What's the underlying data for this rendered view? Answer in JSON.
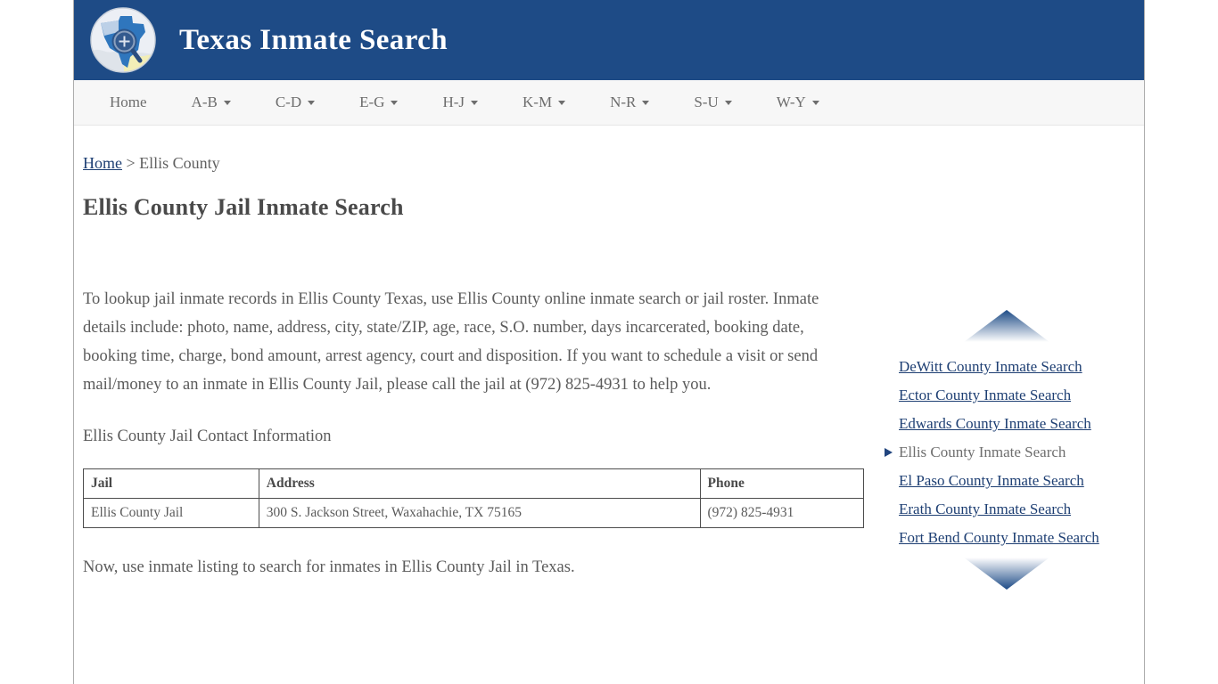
{
  "header": {
    "title": "Texas Inmate Search",
    "logo_icon": "texas-globe-magnifier-icon",
    "background_color": "#1e4b86"
  },
  "nav": {
    "items": [
      {
        "label": "Home",
        "has_caret": false
      },
      {
        "label": "A-B",
        "has_caret": true
      },
      {
        "label": "C-D",
        "has_caret": true
      },
      {
        "label": "E-G",
        "has_caret": true
      },
      {
        "label": "H-J",
        "has_caret": true
      },
      {
        "label": "K-M",
        "has_caret": true
      },
      {
        "label": "N-R",
        "has_caret": true
      },
      {
        "label": "S-U",
        "has_caret": true
      },
      {
        "label": "W-Y",
        "has_caret": true
      }
    ]
  },
  "breadcrumb": {
    "home_label": "Home",
    "separator": " > ",
    "current": "Ellis County"
  },
  "main": {
    "page_title": "Ellis County Jail Inmate Search",
    "intro_paragraph": "To lookup jail inmate records in Ellis County Texas, use Ellis County online inmate search or jail roster. Inmate details include: photo, name, address, city, state/ZIP, age, race, S.O. number, days incarcerated, booking date, booking time, charge, bond amount, arrest agency, court and disposition. If you want to schedule a visit or send mail/money to an inmate in Ellis County Jail, please call the jail at (972) 825-4931 to help you.",
    "contact_heading": "Ellis County Jail Contact Information",
    "outro_paragraph": "Now, use inmate listing to search for inmates in Ellis County Jail in Texas.",
    "table": {
      "headers": [
        "Jail",
        "Address",
        "Phone"
      ],
      "rows": [
        [
          "Ellis County Jail",
          "300 S. Jackson Street, Waxahachie, TX 75165",
          "(972) 825-4931"
        ]
      ]
    }
  },
  "sidebar": {
    "top_arrow_icon": "triangle-up-icon",
    "bottom_arrow_icon": "triangle-down-icon",
    "active_marker_icon": "triangle-right-icon",
    "link_color": "#1e3f73",
    "items": [
      {
        "label": "DeWitt County Inmate Search",
        "active": false
      },
      {
        "label": "Ector County Inmate Search",
        "active": false
      },
      {
        "label": "Edwards County Inmate Search",
        "active": false
      },
      {
        "label": "Ellis County Inmate Search",
        "active": true
      },
      {
        "label": "El Paso County Inmate Search",
        "active": false
      },
      {
        "label": "Erath County Inmate Search",
        "active": false
      },
      {
        "label": "Fort Bend County Inmate Search",
        "active": false
      }
    ]
  }
}
